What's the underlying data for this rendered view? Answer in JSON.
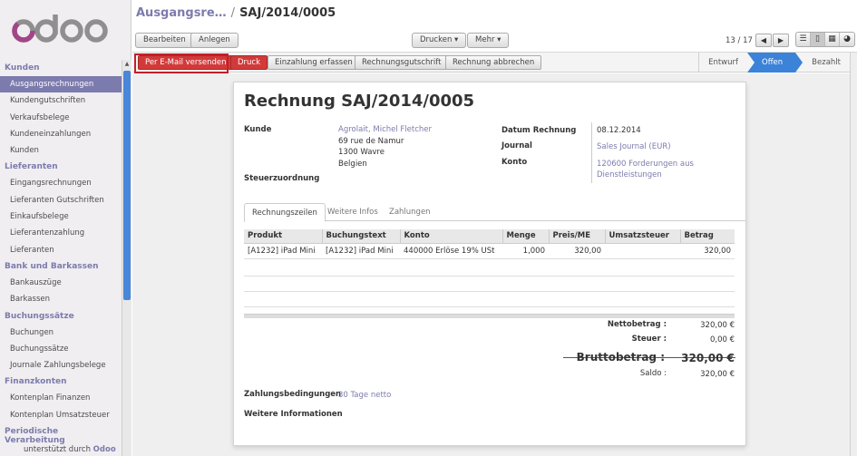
{
  "sidebar": {
    "logo": "odoo",
    "sections": [
      {
        "title": "Kunden",
        "items": [
          "Ausgangsrechnungen",
          "Kundengutschriften",
          "Verkaufsbelege",
          "Kundeneinzahlungen",
          "Kunden"
        ]
      },
      {
        "title": "Lieferanten",
        "items": [
          "Eingangsrechnungen",
          "Lieferanten Gutschriften",
          "Einkaufsbelege",
          "Lieferantenzahlung",
          "Lieferanten"
        ]
      },
      {
        "title": "Bank und Barkassen",
        "items": [
          "Bankauszüge",
          "Barkassen"
        ]
      },
      {
        "title": "Buchungssätze",
        "items": [
          "Buchungen",
          "Buchungssätze",
          "Journale Zahlungsbelege"
        ]
      },
      {
        "title": "Finanzkonten",
        "items": [
          "Kontenplan Finanzen",
          "Kontenplan Umsatzsteuer"
        ]
      },
      {
        "title": "Periodische Verarbeitung",
        "items": []
      }
    ],
    "active_item": "Ausgangsrechnungen",
    "footer_text": "unterstützt durch",
    "footer_brand": "Odoo"
  },
  "header": {
    "breadcrumb_parent": "Ausgangsre…",
    "breadcrumb_sep": "/",
    "breadcrumb_current": "SAJ/2014/0005",
    "edit_label": "Bearbeiten",
    "create_label": "Anlegen",
    "print_label": "Drucken ▾",
    "more_label": "Mehr ▾",
    "pager": "13 / 17"
  },
  "statusbar": {
    "send_email": "Per E-Mail versenden",
    "print": "Druck",
    "register_payment": "Einzahlung erfassen",
    "refund": "Rechnungsgutschrift",
    "cancel": "Rechnung abbrechen",
    "states": [
      "Entwurf",
      "Offen",
      "Bezahlt"
    ],
    "current_state": "Offen"
  },
  "form": {
    "title": "Rechnung SAJ/2014/0005",
    "customer_label": "Kunde",
    "customer_name": "Agrolait, Michel Fletcher",
    "customer_street": "69 rue de Namur",
    "customer_city": "1300 Wavre",
    "customer_country": "Belgien",
    "fiscal_position_label": "Steuerzuordnung",
    "invoice_date_label": "Datum Rechnung",
    "invoice_date": "08.12.2014",
    "journal_label": "Journal",
    "journal": "Sales Journal (EUR)",
    "account_label": "Konto",
    "account_line1": "120600 Forderungen aus",
    "account_line2": "Dienstleistungen",
    "tabs": [
      "Rechnungszeilen",
      "Weitere Infos",
      "Zahlungen"
    ],
    "columns": [
      "Produkt",
      "Buchungstext",
      "Konto",
      "Menge",
      "Preis/ME",
      "Umsatzsteuer",
      "Betrag"
    ],
    "lines": [
      {
        "product": "[A1232] iPad Mini",
        "description": "[A1232] iPad Mini",
        "account": "440000 Erlöse 19% USt",
        "qty": "1,000",
        "price": "320,00",
        "tax": "",
        "amount": "320,00"
      }
    ],
    "net_label": "Nettobetrag :",
    "net_value": "320,00 €",
    "tax_label": "Steuer :",
    "tax_value": "0,00 €",
    "gross_label": "Bruttobetrag :",
    "gross_value": "320,00 €",
    "balance_label": "Saldo :",
    "balance_value": "320,00 €",
    "payment_terms_label": "Zahlungsbedingungen",
    "payment_terms": "30 Tage netto",
    "more_info_label": "Weitere Informationen"
  },
  "colors": {
    "brand": "#7c7bad",
    "accent_red": "#d23a3a",
    "state_blue": "#3b82d9"
  }
}
